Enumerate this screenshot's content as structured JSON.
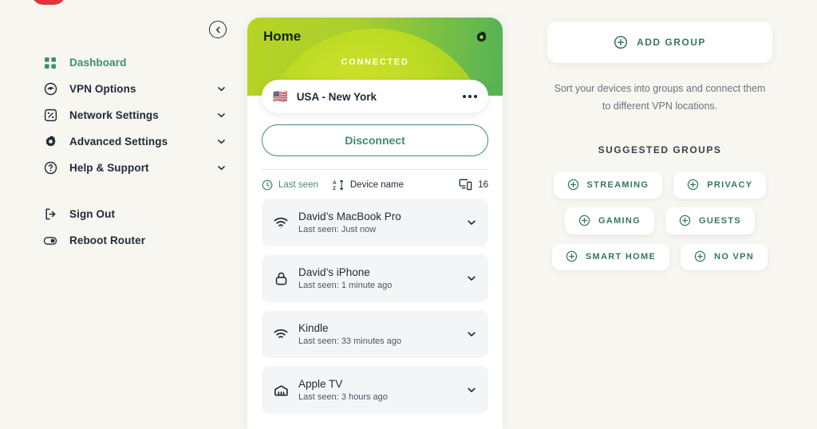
{
  "sidebar": {
    "collapse_label": "Collapse sidebar",
    "items": [
      {
        "label": "Dashboard",
        "icon": "grid-icon",
        "active": true,
        "chevron": false
      },
      {
        "label": "VPN Options",
        "icon": "vpn-shield-icon",
        "active": false,
        "chevron": true
      },
      {
        "label": "Network Settings",
        "icon": "network-icon",
        "active": false,
        "chevron": true
      },
      {
        "label": "Advanced Settings",
        "icon": "gear-icon",
        "active": false,
        "chevron": true
      },
      {
        "label": "Help & Support",
        "icon": "question-circle-icon",
        "active": false,
        "chevron": true
      }
    ],
    "footer_items": [
      {
        "label": "Sign Out",
        "icon": "sign-out-icon"
      },
      {
        "label": "Reboot Router",
        "icon": "power-toggle-icon"
      }
    ]
  },
  "center": {
    "title": "Home",
    "status": "CONNECTED",
    "location": {
      "flag": "🇺🇸",
      "name": "USA - New York"
    },
    "disconnect_label": "Disconnect",
    "sort": {
      "last_seen_label": "Last seen",
      "device_name_label": "Device name"
    },
    "device_count": "16",
    "devices": [
      {
        "name": "David’s MacBook Pro",
        "last_seen": "Last seen: Just now",
        "icon": "wifi-icon"
      },
      {
        "name": "David’s iPhone",
        "last_seen": "Last seen: 1 minute ago",
        "icon": "lock-icon"
      },
      {
        "name": "Kindle",
        "last_seen": "Last seen: 33 minutes ago",
        "icon": "wifi-icon"
      },
      {
        "name": "Apple TV",
        "last_seen": "Last seen: 3 hours ago",
        "icon": "tv-icon"
      }
    ]
  },
  "right": {
    "add_group_label": "ADD GROUP",
    "hint": "Sort your devices into groups and connect them to different VPN locations.",
    "suggested_title": "SUGGESTED GROUPS",
    "chip_rows": [
      [
        {
          "label": "STREAMING"
        },
        {
          "label": "PRIVACY"
        }
      ],
      [
        {
          "label": "GAMING"
        },
        {
          "label": "GUESTS"
        }
      ],
      [
        {
          "label": "SMART HOME"
        },
        {
          "label": "NO VPN"
        }
      ]
    ]
  },
  "colors": {
    "background": "#f7f6f1",
    "accent_green": "#3f8e6d",
    "hero_lime": "#bada22",
    "hero_green": "#55b257",
    "brand_red": "#e5333a",
    "text_dark": "#1f2a37"
  }
}
